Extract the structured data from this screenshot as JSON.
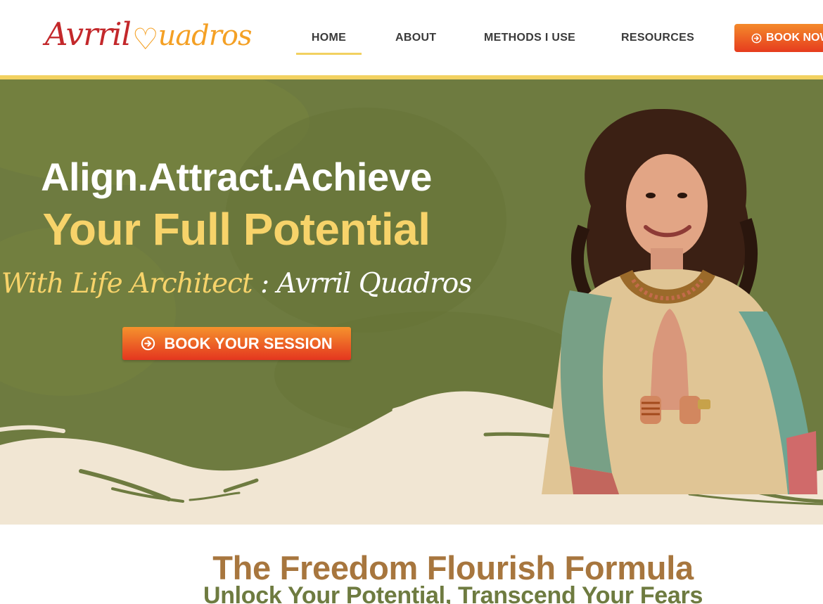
{
  "header": {
    "logo": {
      "part1": "Avrril",
      "part2": "uadros"
    },
    "nav": [
      {
        "label": "HOME",
        "active": true
      },
      {
        "label": "ABOUT"
      },
      {
        "label": "METHODS I USE"
      },
      {
        "label": "RESOURCES"
      }
    ],
    "cta_label": "BOOK NOW"
  },
  "hero": {
    "line1": "Align.Attract.Achieve",
    "line2": "Your Full Potential",
    "line3_gold": "With Life Architect",
    "line3_white": " : Avrril Quadros",
    "cta_label": "BOOK YOUR SESSION",
    "cta_icon": "arrow-circle-right-icon"
  },
  "section": {
    "title": "The Freedom Flourish Formula",
    "subtitle": "Unlock Your Potential, Transcend Your Fears"
  },
  "colors": {
    "accent_gold": "#f2d160",
    "hero_green": "#6e7b40",
    "cream": "#f1e6d3",
    "cta_orange": "#f5922d",
    "cta_red": "#e4361f",
    "title_brown": "#a7763e",
    "logo_red": "#c3282b",
    "logo_orange": "#f4a024"
  }
}
